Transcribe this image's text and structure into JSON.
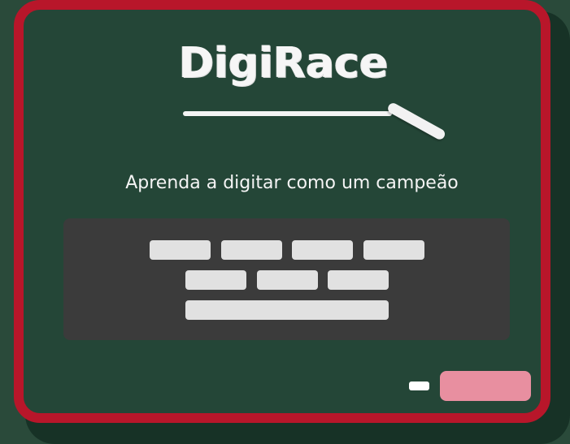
{
  "app": {
    "logo_text": "DigiRace",
    "tagline": "Aprenda a digitar como um campeão"
  },
  "keyboard": {
    "rows": [
      {
        "keys": 4
      },
      {
        "keys": 3
      },
      {
        "keys": 1,
        "type": "spacebar"
      }
    ]
  },
  "actions": {
    "small_button_label": "",
    "primary_button_label": ""
  },
  "colors": {
    "frame": "#b8162a",
    "board": "#244637",
    "keyboard": "#3b3b3b",
    "key": "#e1e1e1",
    "primary_button": "#e88fa0",
    "chalk": "#f4f4f4"
  },
  "icons": {
    "chalk": "chalk-stick-icon"
  }
}
